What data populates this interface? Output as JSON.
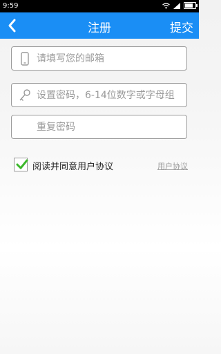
{
  "status_bar": {
    "time": "9:59"
  },
  "nav": {
    "title": "注册",
    "submit_label": "提交"
  },
  "form": {
    "email_placeholder": "请填写您的邮箱",
    "password_placeholder": "设置密码，6-14位数字或字母组",
    "confirm_placeholder": "重复密码"
  },
  "agreement": {
    "checked": true,
    "label": "阅读并同意用户协议",
    "link": "用户协议"
  },
  "colors": {
    "accent": "#1a8ef5",
    "check": "#3cb82b"
  }
}
